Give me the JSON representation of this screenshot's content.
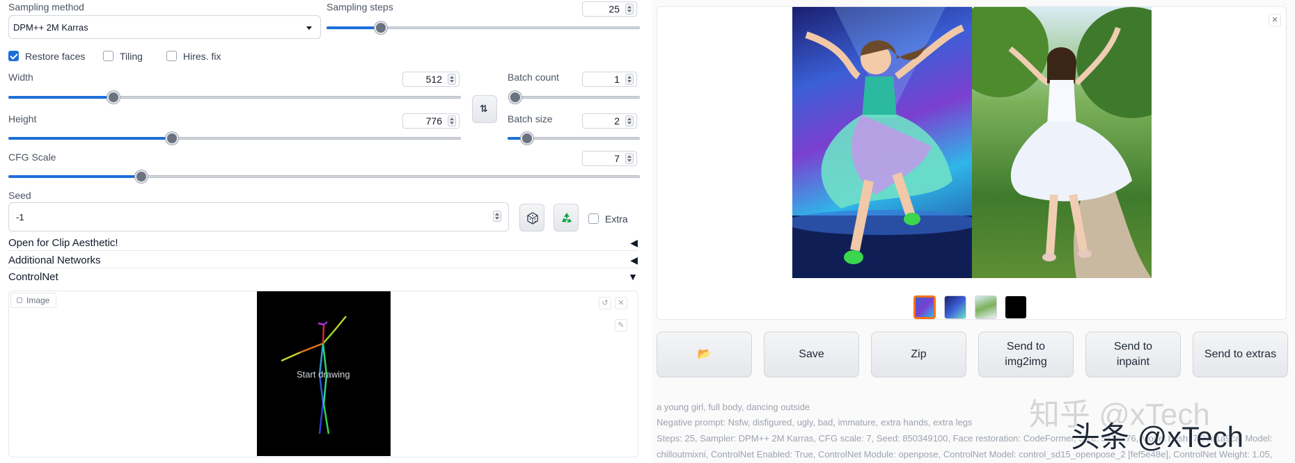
{
  "sampling": {
    "method_label": "Sampling method",
    "method_value": "DPM++ 2M Karras",
    "steps_label": "Sampling steps",
    "steps_value": "25",
    "steps_fraction": 0.17
  },
  "options": {
    "restore_faces": "Restore faces",
    "restore_faces_checked": true,
    "tiling": "Tiling",
    "tiling_checked": false,
    "hires_fix": "Hires. fix",
    "hires_fix_checked": false
  },
  "width": {
    "label": "Width",
    "value": "512",
    "fraction": 0.23
  },
  "height": {
    "label": "Height",
    "value": "776",
    "fraction": 0.36
  },
  "batch_count": {
    "label": "Batch count",
    "value": "1",
    "fraction": 0.0
  },
  "batch_size": {
    "label": "Batch size",
    "value": "2",
    "fraction": 0.14
  },
  "cfg": {
    "label": "CFG Scale",
    "value": "7",
    "fraction": 0.21
  },
  "seed": {
    "label": "Seed",
    "value": "-1",
    "extra_label": "Extra"
  },
  "accordions": {
    "clip_aesthetic": "Open for Clip Aesthetic!",
    "additional_networks": "Additional Networks",
    "controlnet": "ControlNet"
  },
  "controlnet": {
    "image_tab": "Image",
    "start_drawing": "Start drawing"
  },
  "gallery": {
    "thumbnail_count": 4,
    "selected_index": 0
  },
  "actions": {
    "folder": "📂",
    "save": "Save",
    "zip": "Zip",
    "send_img2img": "Send to img2img",
    "send_inpaint": "Send to inpaint",
    "send_extras": "Send to extras"
  },
  "generation_info": {
    "prompt": "a young girl, full body, dancing outside",
    "negative": "Negative prompt: Nsfw, disfigured, ugly, bad, immature, extra hands, extra legs",
    "params": "Steps: 25, Sampler: DPM++ 2M Karras, CFG scale: 7, Seed: 850349100, Face restoration: CodeFormer, Size: 512x776, Model hash: 7f96a1a9ca, Model:",
    "params2": "chilloutmixni, ControlNet Enabled: True, ControlNet Module: openpose, ControlNet Model: control_sd15_openpose_2 [fef5e48e], ControlNet Weight: 1.05,"
  },
  "watermark": {
    "line1": "知乎 @xTech",
    "line2": "头条 @xTech"
  },
  "colors": {
    "accent": "#1d6fd8",
    "thumb_selected_border": "#f97316"
  }
}
